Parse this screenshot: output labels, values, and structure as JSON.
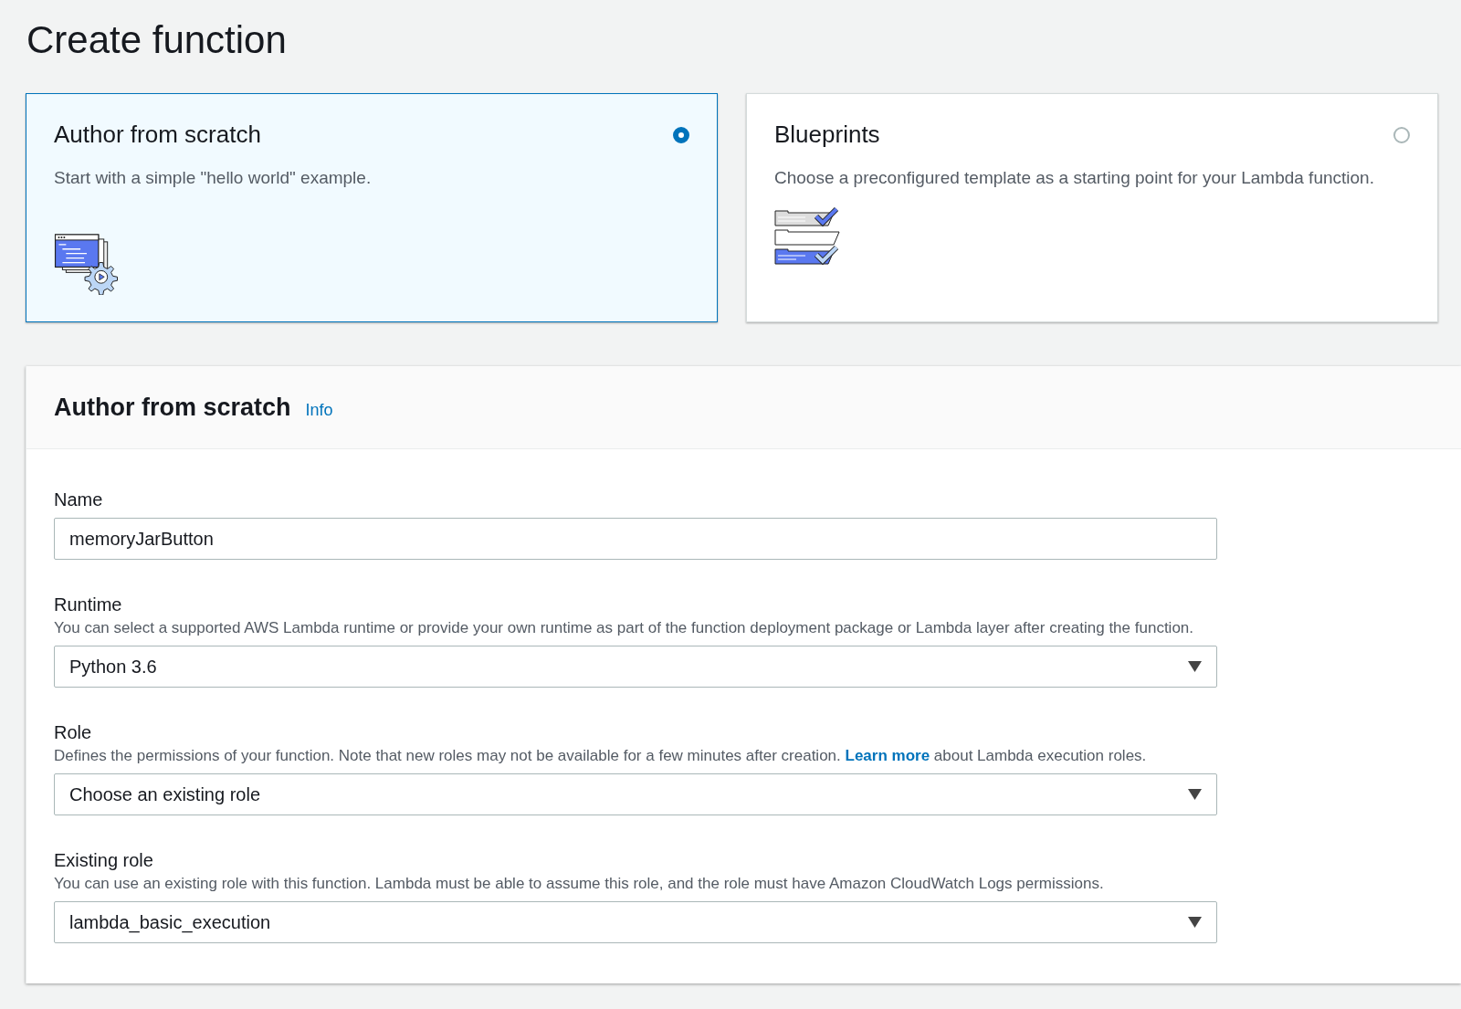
{
  "page_title": "Create function",
  "options": [
    {
      "kind": "scratch",
      "title": "Author from scratch",
      "description": "Start with a simple \"hello world\" example.",
      "selected": true
    },
    {
      "kind": "blueprints",
      "title": "Blueprints",
      "description": "Choose a preconfigured template as a starting point for your Lambda function.",
      "selected": false
    }
  ],
  "panel": {
    "title": "Author from scratch",
    "info_link": "Info",
    "fields": [
      {
        "kind": "input",
        "label": "Name",
        "value": "memoryJarButton"
      },
      {
        "kind": "select",
        "label": "Runtime",
        "description": "You can select a supported AWS Lambda runtime or provide your own runtime as part of the function deployment package or Lambda layer after creating the function.",
        "value": "Python 3.6"
      },
      {
        "kind": "select",
        "label": "Role",
        "link": "Learn more",
        "description_after": "about Lambda execution roles.",
        "description_before": "Defines the permissions of your function. Note that new roles may not be available for a few minutes after creation.",
        "value": "Choose an existing role"
      },
      {
        "kind": "select",
        "label": "Existing role",
        "description": "You can use an existing role with this function. Lambda must be able to assume this role, and the role must have Amazon CloudWatch Logs permissions.",
        "value": "lambda_basic_execution"
      }
    ]
  }
}
